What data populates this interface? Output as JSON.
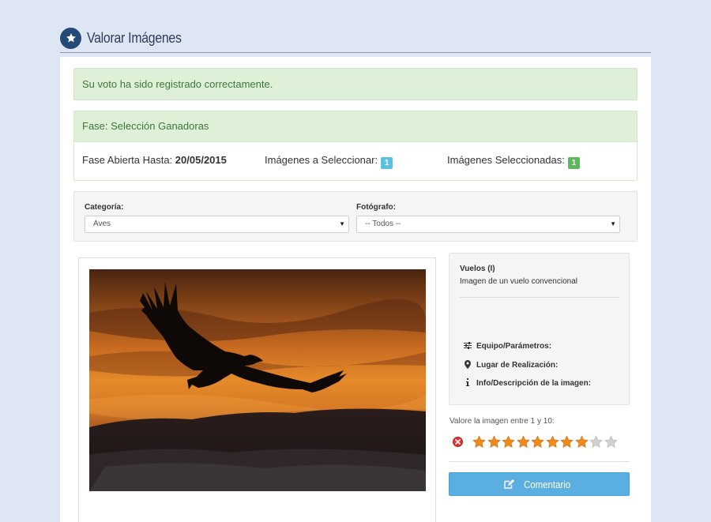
{
  "header": {
    "title": "Valorar Imágenes",
    "icon": "star-icon",
    "accent_color": "#264a78"
  },
  "alert": {
    "message": "Su voto ha sido registrado correctamente."
  },
  "fase": {
    "title": "Fase: Selección Ganadoras",
    "abierta_label": "Fase Abierta Hasta:",
    "abierta_value": "20/05/2015",
    "a_seleccionar_label": "Imágenes a Seleccionar:",
    "a_seleccionar_value": "1",
    "seleccionadas_label": "Imágenes Seleccionadas:",
    "seleccionadas_value": "1"
  },
  "filters": {
    "categoria_label": "Categoría:",
    "categoria_value": "Aves",
    "fotografo_label": "Fotógrafo:",
    "fotografo_value": "-- Todos --"
  },
  "image_info": {
    "title": "Vuelos (I)",
    "description": "Imagen de un vuelo convencional",
    "equipo_label": "Equipo/Parámetros:",
    "lugar_label": "Lugar de Realización:",
    "info_label": "Info/Descripción de la imagen:"
  },
  "rating": {
    "label": "Valore la imagen entre 1 y 10:",
    "value": 8,
    "max": 10,
    "filled_color": "#f08a1c",
    "empty_color": "#d0d0d0"
  },
  "comment_button": {
    "label": "Comentario",
    "icon": "edit-icon",
    "color": "#5aaee2"
  }
}
